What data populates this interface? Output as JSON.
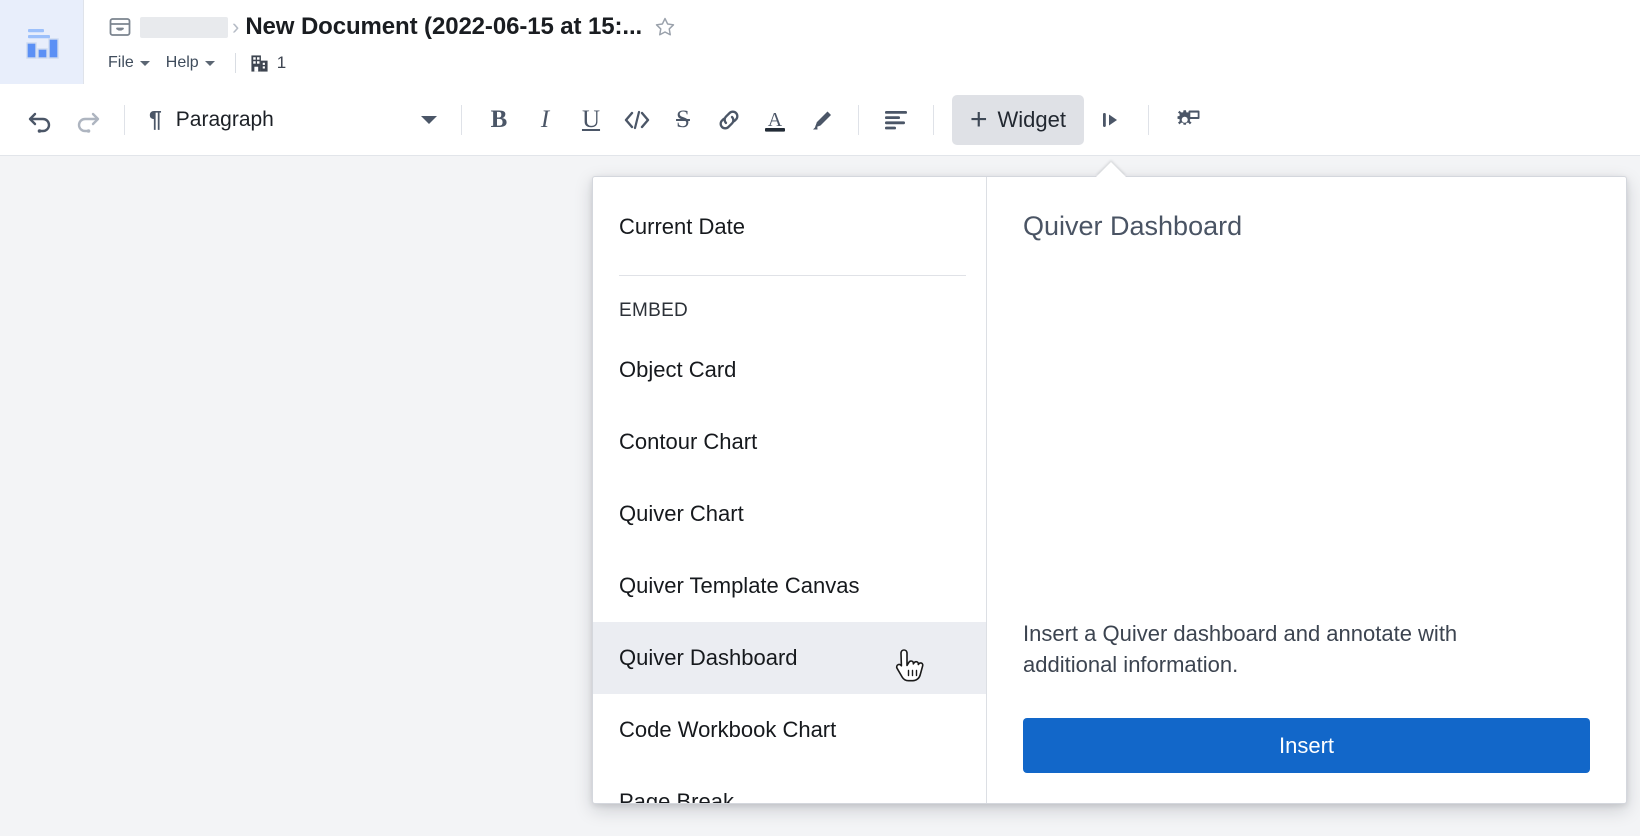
{
  "app": {
    "logo_icon": "bar-chart-logo-icon"
  },
  "header": {
    "breadcrumb": {
      "folder_icon": "folder-icon",
      "redacted_label": "",
      "separator": "›"
    },
    "doc_title": "New Document (2022-06-15 at 15:...",
    "star_icon": "star-outline-icon",
    "menus": [
      {
        "label": "File",
        "caret_icon": "chevron-down-icon"
      },
      {
        "label": "Help",
        "caret_icon": "chevron-down-icon"
      }
    ],
    "org": {
      "icon": "building-icon",
      "count": "1"
    }
  },
  "toolbar": {
    "undo": {
      "label": "Undo",
      "icon": "undo-icon",
      "enabled": true
    },
    "redo": {
      "label": "Redo",
      "icon": "redo-icon",
      "enabled": false
    },
    "paragraph_select": {
      "glyph": "¶",
      "label": "Paragraph",
      "caret_icon": "chevron-down-icon"
    },
    "format_buttons": [
      {
        "name": "bold",
        "label": "B",
        "icon": "bold-icon"
      },
      {
        "name": "italic",
        "label": "I",
        "icon": "italic-icon"
      },
      {
        "name": "underline",
        "label": "U",
        "icon": "underline-icon"
      },
      {
        "name": "code",
        "label": "</>",
        "icon": "code-icon"
      },
      {
        "name": "strikethrough",
        "label": "S",
        "icon": "strikethrough-icon"
      },
      {
        "name": "link",
        "label": "",
        "icon": "link-icon"
      },
      {
        "name": "text-color",
        "label": "A",
        "icon": "text-color-icon"
      },
      {
        "name": "highlight",
        "label": "",
        "icon": "highlighter-icon"
      }
    ],
    "align_icon": "align-left-icon",
    "widget_button": {
      "plus": "+",
      "label": "Widget",
      "icon": "plus-icon"
    },
    "indent_icon": "indent-right-icon",
    "settings_icon": "gear-window-icon"
  },
  "widget_popup": {
    "options": [
      {
        "label": "Current Date",
        "selected": false
      },
      {
        "label": "Object Card",
        "selected": false
      },
      {
        "label": "Contour Chart",
        "selected": false
      },
      {
        "label": "Quiver Chart",
        "selected": false
      },
      {
        "label": "Quiver Template Canvas",
        "selected": false
      },
      {
        "label": "Quiver Dashboard",
        "selected": true
      },
      {
        "label": "Code Workbook Chart",
        "selected": false
      },
      {
        "label": "Page Break",
        "selected": false
      }
    ],
    "section_header": "EMBED",
    "preview": {
      "title": "Quiver Dashboard",
      "description": "Insert a Quiver dashboard and annotate with additional information.",
      "insert_label": "Insert"
    }
  },
  "cursor": {
    "icon": "pointing-hand-cursor"
  },
  "colors": {
    "accent_blue": "#1267c9",
    "logo_blue": "#5b90f5",
    "logo_bg": "#e8eefb",
    "canvas_bg": "#f3f4f6",
    "selected_row": "#ebedf2",
    "widget_btn_bg": "#dfe1e6",
    "icon_slate": "#4b5667"
  }
}
